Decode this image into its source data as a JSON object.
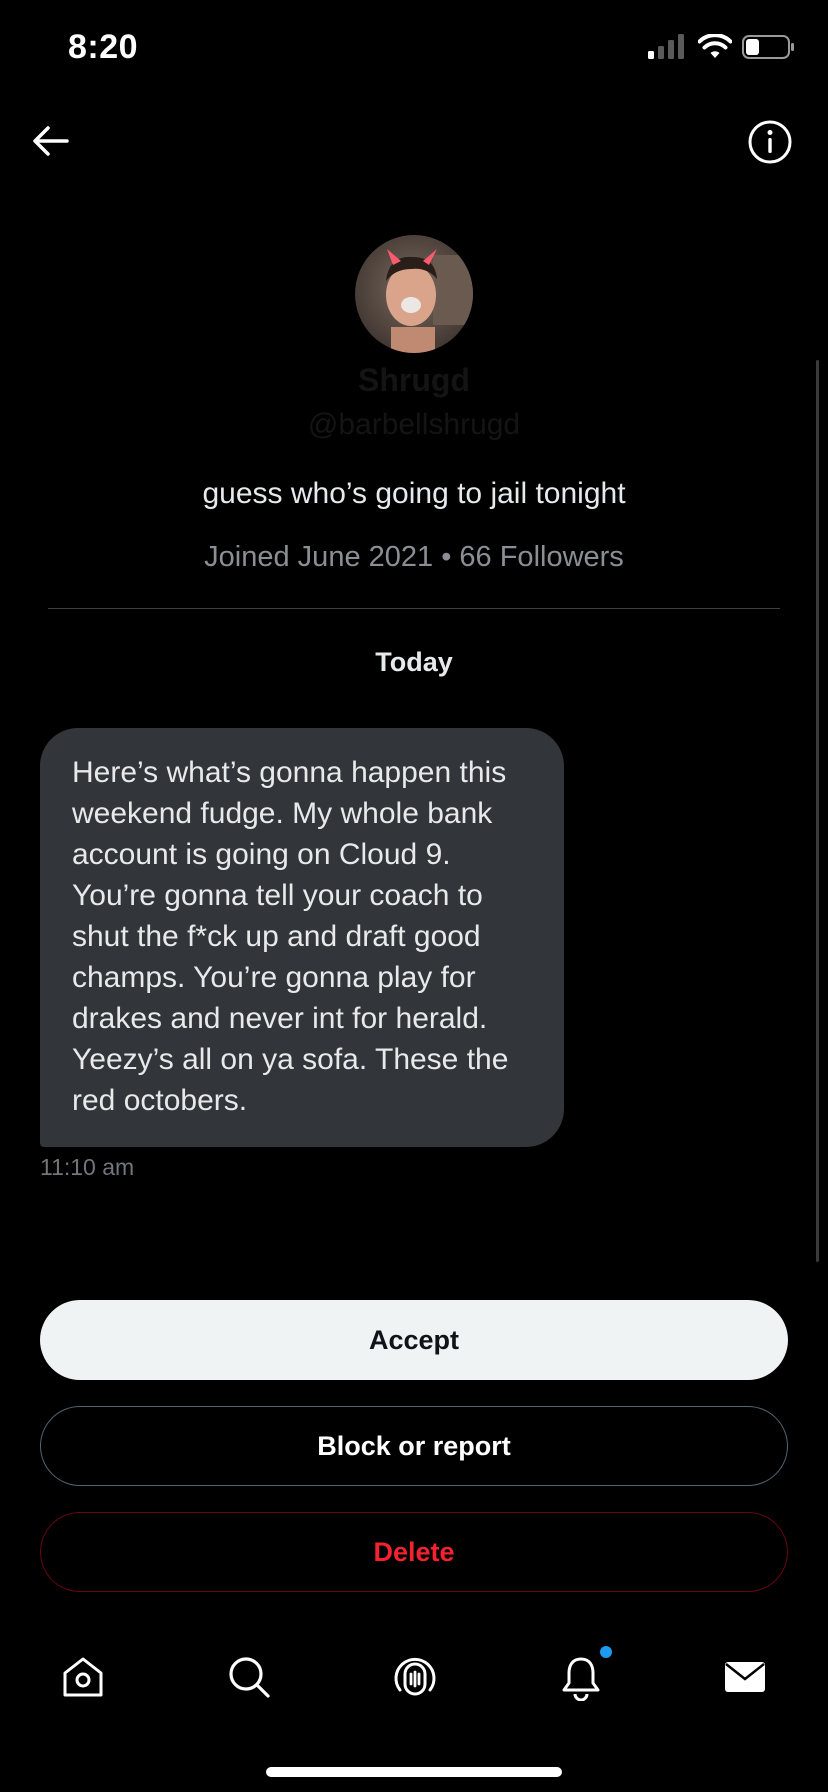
{
  "status_bar": {
    "time": "8:20",
    "icons": [
      "cellular-signal-icon",
      "wifi-icon",
      "battery-icon"
    ]
  },
  "header": {
    "back_icon": "arrow-left-icon",
    "info_icon": "info-circle-icon"
  },
  "profile": {
    "name": "Shrugd",
    "handle": "@barbellshrugd",
    "bio": "guess who’s going to jail tonight",
    "meta": "Joined June 2021 • 66 Followers"
  },
  "conversation": {
    "date_label": "Today",
    "messages": [
      {
        "text": "Here’s what’s gonna happen this weekend fudge. My whole bank account is going on Cloud 9. You’re gonna tell your coach to shut the f*ck up and draft good champs. You’re gonna play for drakes and never int for herald. Yeezy’s all on ya sofa. These the red octobers.",
        "time": "11:10 am"
      }
    ]
  },
  "actions": {
    "accept": "Accept",
    "block_or_report": "Block or report",
    "delete": "Delete"
  },
  "bottom_nav": {
    "items": [
      "home-icon",
      "search-icon",
      "spaces-icon",
      "notifications-icon",
      "messages-icon"
    ],
    "notification_dot_color": "#1d9bf0"
  },
  "colors": {
    "background": "#000000",
    "bubble": "#323539",
    "accept_bg": "#eff3f4",
    "delete_text": "#f4212e"
  }
}
